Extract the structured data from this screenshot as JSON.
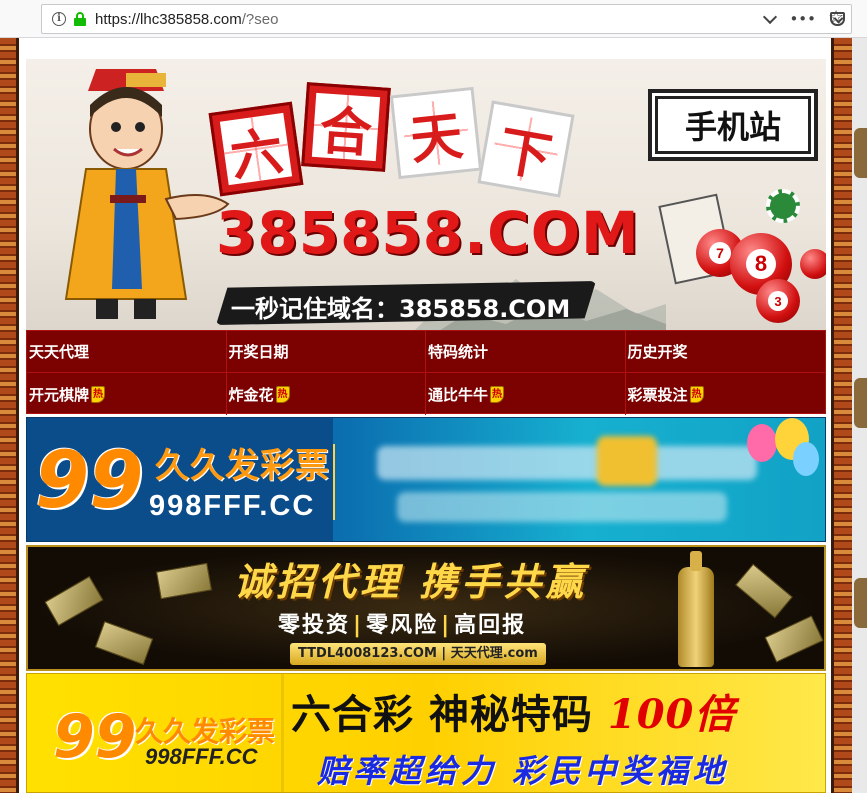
{
  "browser": {
    "url_host": "https://lhc385858.com",
    "url_path": "/?seo",
    "more_label": "•••"
  },
  "header": {
    "title_chars": [
      "六",
      "合",
      "天",
      "下"
    ],
    "domain": "385858.COM",
    "slogan": "一秒记住域名：385858.COM",
    "mobile_label": "手机站",
    "ball_numbers": [
      "7",
      "8",
      "3"
    ]
  },
  "nav": {
    "items": [
      {
        "label": "天天代理",
        "hot": false
      },
      {
        "label": "开奖日期",
        "hot": false
      },
      {
        "label": "特码统计",
        "hot": false
      },
      {
        "label": "历史开奖",
        "hot": false
      },
      {
        "label": "开元棋牌",
        "hot": true
      },
      {
        "label": "炸金花",
        "hot": true
      },
      {
        "label": "通比牛牛",
        "hot": true
      },
      {
        "label": "彩票投注",
        "hot": true
      }
    ],
    "hot_text": "热"
  },
  "ads": {
    "ad1": {
      "logo": "99",
      "brand": "久久发彩票",
      "domain": "998FFF.CC"
    },
    "ad2": {
      "title": "诚招代理 携手共赢",
      "sub": [
        "零投资",
        "零风险",
        "高回报"
      ],
      "url": "TTDL4008123.COM | 天天代理.com"
    },
    "ad3": {
      "logo": "99",
      "brand": "久久发彩票",
      "domain": "998FFF.CC",
      "title_main": "六合彩  神秘特码",
      "title_red": "100倍",
      "sub": "赔率超给力  彩民中奖福地"
    }
  },
  "colors": {
    "nav_bg": "#7c0202",
    "banner_red": "#e01818",
    "ad1_blue": "#0b4c8a",
    "ad3_yellow": "#ffd000"
  }
}
